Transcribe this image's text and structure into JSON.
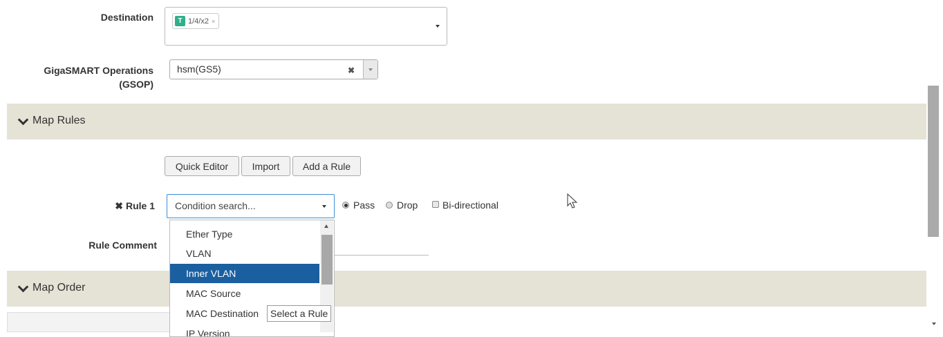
{
  "destination": {
    "label": "Destination",
    "chips": [
      {
        "badge": "T",
        "text": "1/4/x2",
        "remove": "×"
      }
    ]
  },
  "gsop": {
    "label_line1": "GigaSMART Operations",
    "label_line2": "(GSOP)",
    "value": "hsm(GS5)",
    "clear": "✖"
  },
  "map_rules": {
    "title": "Map Rules",
    "buttons": {
      "quick_editor": "Quick Editor",
      "import": "Import",
      "add_rule": "Add a Rule"
    }
  },
  "rule": {
    "remove_icon": "✖",
    "label": "Rule 1",
    "condition_placeholder": "Condition search...",
    "options": {
      "pass": "Pass",
      "drop": "Drop",
      "bidirectional": "Bi-directional"
    },
    "selected_action": "Pass",
    "comment_label": "Rule Comment"
  },
  "dropdown": {
    "items": [
      "Ether Type",
      "VLAN",
      "Inner VLAN",
      "MAC Source",
      "MAC Destination",
      "IP Version"
    ],
    "highlighted": "Inner VLAN",
    "tooltip": "Select a Rule"
  },
  "map_order": {
    "title": "Map Order"
  }
}
